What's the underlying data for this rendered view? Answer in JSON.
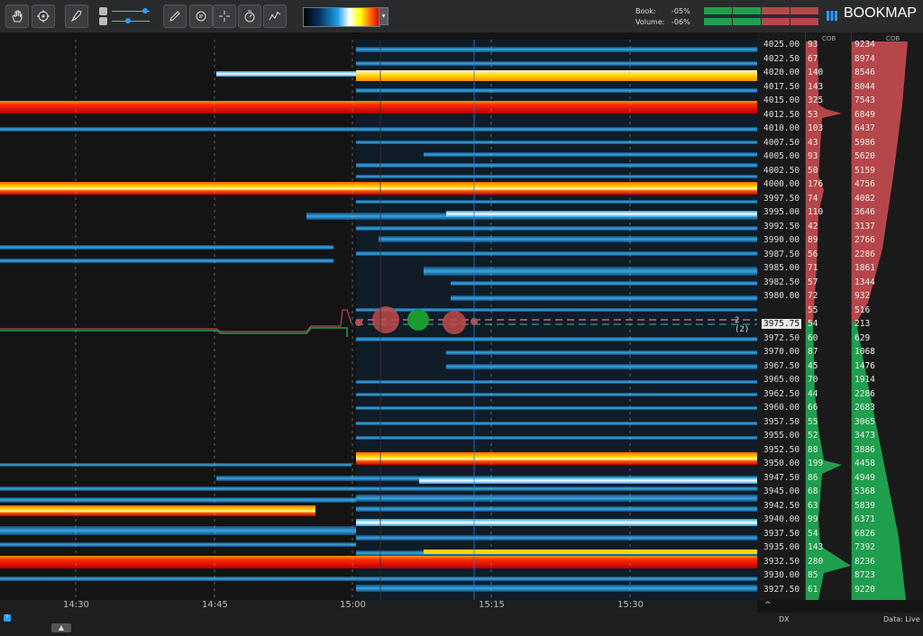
{
  "toolbar": {
    "buttons": [
      "hand-tool-icon",
      "target-icon",
      "rocket-icon",
      "pencil-icon",
      "chat-icon",
      "crosshair-icon",
      "timer-icon",
      "trend-icon"
    ],
    "colormap_dropdown": "▾",
    "book_label": "Book:",
    "book_value": "-05%",
    "volume_label": "Volume:",
    "volume_value": "-06%",
    "brand": "BOOKMAP"
  },
  "price_axis": {
    "labels": [
      "4025.00",
      "4022.50",
      "4020.00",
      "4017.50",
      "4015.00",
      "4012.50",
      "4010.00",
      "4007.50",
      "4005.00",
      "4002.50",
      "4000.00",
      "3997.50",
      "3995.00",
      "3992.50",
      "3990.00",
      "3987.50",
      "3985.00",
      "3982.50",
      "3980.00",
      "",
      "3975.75",
      "3972.50",
      "3970.00",
      "3967.50",
      "3965.00",
      "3962.50",
      "3960.00",
      "3957.50",
      "3955.00",
      "3952.50",
      "3950.00",
      "3947.50",
      "3945.00",
      "3942.50",
      "3940.00",
      "3937.50",
      "3935.00",
      "3932.50",
      "3930.00",
      "3927.50"
    ],
    "current_price": "3975.75",
    "current_marker": "2 (2)"
  },
  "cob1": {
    "header": "COB",
    "values": [
      "93",
      "67",
      "140",
      "143",
      "325",
      "53",
      "103",
      "43",
      "93",
      "50",
      "176",
      "74",
      "110",
      "42",
      "89",
      "56",
      "71",
      "57",
      "72",
      "55",
      "54",
      "60",
      "87",
      "45",
      "70",
      "44",
      "66",
      "55",
      "52",
      "88",
      "199",
      "86",
      "68",
      "63",
      "99",
      "54",
      "143",
      "280",
      "85",
      "61"
    ]
  },
  "cob2": {
    "header": "COB",
    "values": [
      "9234",
      "8974",
      "8546",
      "8044",
      "7543",
      "6849",
      "6437",
      "5986",
      "5620",
      "5159",
      "4756",
      "4082",
      "3646",
      "3137",
      "2766",
      "2286",
      "1861",
      "1344",
      "932",
      "516",
      "213",
      "629",
      "1068",
      "1476",
      "1914",
      "2286",
      "2683",
      "3065",
      "3473",
      "3886",
      "4458",
      "4949",
      "5368",
      "5839",
      "6371",
      "6826",
      "7392",
      "8236",
      "8723",
      "9220"
    ]
  },
  "time_axis": {
    "labels": [
      "14:30",
      "14:45",
      "15:00",
      "15:15",
      "15:30"
    ]
  },
  "footer": {
    "dx": "DX",
    "status": "Data: Live"
  },
  "colors": {
    "ask": "#b5474a",
    "bid": "#1f9e4e",
    "accent": "#2b9bff"
  }
}
